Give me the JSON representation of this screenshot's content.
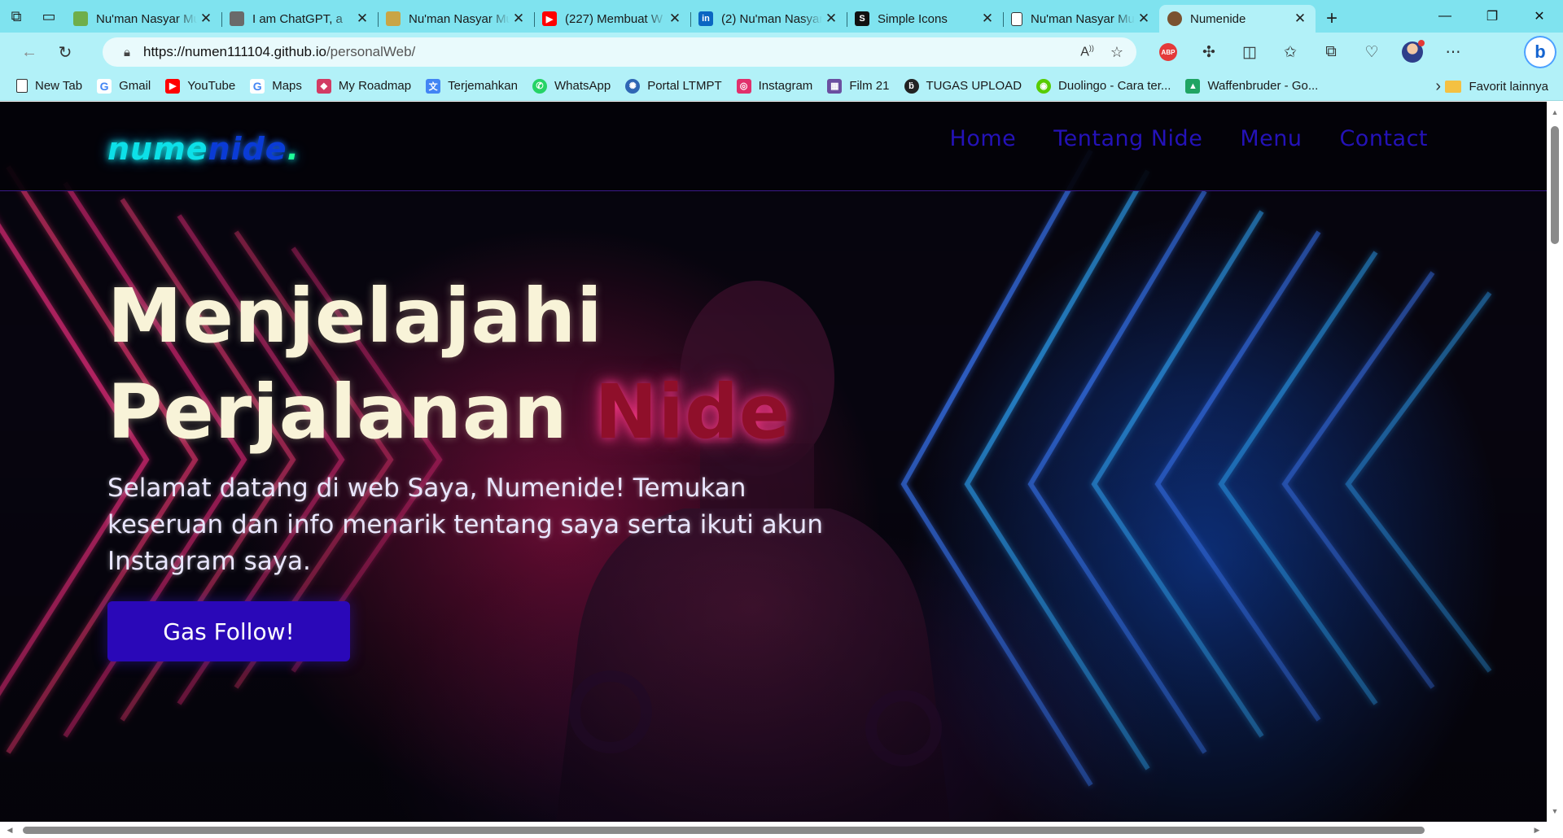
{
  "browser": {
    "tabs": [
      {
        "title": "Nu'man Nasyar Mubarak",
        "favicon": "bamboo-icon",
        "color": "#6fae4a"
      },
      {
        "title": "I am ChatGPT, a",
        "favicon": "openai-icon",
        "color": "#6a6a6a"
      },
      {
        "title": "Nu'man Nasyar Mubarak",
        "favicon": "bamboo-icon",
        "color": "#c9a545"
      },
      {
        "title": "(227) Membuat W",
        "favicon": "youtube-icon",
        "color": "#ff0000"
      },
      {
        "title": "(2) Nu'man Nasyar",
        "favicon": "linkedin-icon",
        "color": "#0a66c2"
      },
      {
        "title": "Simple Icons",
        "favicon": "simpleicons-icon",
        "color": "#111111"
      },
      {
        "title": "Nu'man Nasyar Mubarak",
        "favicon": "page-icon",
        "color": "#ffffff"
      },
      {
        "title": "Numenide",
        "favicon": "avatar-icon",
        "color": "#7a5230",
        "active": true
      }
    ],
    "url_host": "https://numen111104.github.io",
    "url_path": "/personalWeb/",
    "bookmarks": [
      {
        "label": "New Tab",
        "icon": "page-icon",
        "color": "#ffffff",
        "glyph": ""
      },
      {
        "label": "Gmail",
        "icon": "google-icon",
        "color": "#ffffff",
        "glyph": "G"
      },
      {
        "label": "YouTube",
        "icon": "youtube-icon",
        "color": "#ff0000",
        "glyph": "▶"
      },
      {
        "label": "Maps",
        "icon": "google-icon",
        "color": "#ffffff",
        "glyph": "G"
      },
      {
        "label": "My Roadmap",
        "icon": "roadmap-icon",
        "color": "#d23c64",
        "glyph": "◆"
      },
      {
        "label": "Terjemahkan",
        "icon": "translate-icon",
        "color": "#4285f4",
        "glyph": "文"
      },
      {
        "label": "WhatsApp",
        "icon": "whatsapp-icon",
        "color": "#25d366",
        "glyph": "✆"
      },
      {
        "label": "Portal LTMPT",
        "icon": "ltmpt-icon",
        "color": "#2f66b4",
        "glyph": "✺"
      },
      {
        "label": "Instagram",
        "icon": "instagram-icon",
        "color": "#e1306c",
        "glyph": "◎"
      },
      {
        "label": "Film 21",
        "icon": "film-icon",
        "color": "#6b4fa0",
        "glyph": "▦"
      },
      {
        "label": "TUGAS UPLOAD",
        "icon": "upload-icon",
        "color": "#222222",
        "glyph": "ḃ"
      },
      {
        "label": "Duolingo - Cara ter...",
        "icon": "duolingo-icon",
        "color": "#58cc02",
        "glyph": "◉"
      },
      {
        "label": "Waffenbruder - Go...",
        "icon": "drive-icon",
        "color": "#1fa463",
        "glyph": "▲"
      }
    ],
    "other_bookmarks": "Favorit lainnya"
  },
  "site": {
    "logo_part1": "nume",
    "logo_part2": "nide",
    "logo_dot": ".",
    "nav": [
      "Home",
      "Tentang Nide",
      "Menu",
      "Contact"
    ],
    "hero_line1": "Menjelajahi",
    "hero_line2_a": "Perjalanan ",
    "hero_line2_b": "Nide",
    "hero_text": "Selamat datang di web Saya, Numenide! Temukan keseruan dan info menarik tentang saya serta ikuti akun Instagram saya.",
    "cta_label": "Gas Follow!"
  },
  "colors": {
    "browser_chrome": "#b2f1f8",
    "tab_strip": "#7fe3ef",
    "logo_cyan": "#0de0e8",
    "logo_blue": "#0a3bd6",
    "nav_link": "#2412b8",
    "hero_title": "#f8f3d8",
    "hero_accent": "#8f0f2a",
    "cta_bg": "#2a08b8"
  }
}
